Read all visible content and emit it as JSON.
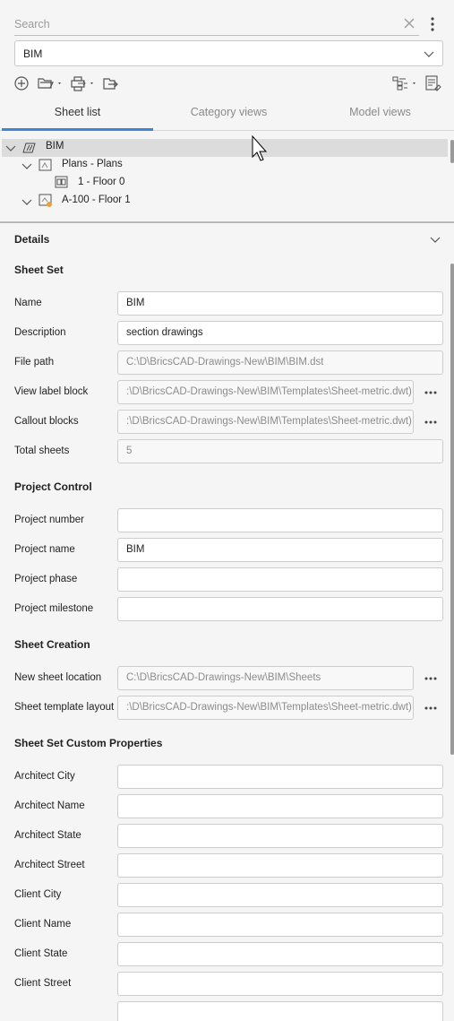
{
  "search": {
    "placeholder": "Search"
  },
  "sheetset_select": {
    "value": "BIM"
  },
  "tabs": [
    {
      "label": "Sheet list",
      "active": true
    },
    {
      "label": "Category views",
      "active": false
    },
    {
      "label": "Model views",
      "active": false
    }
  ],
  "tree": {
    "root": "BIM",
    "subset": "Plans - Plans",
    "view": "1 - Floor 0",
    "sheet": "A-100 - Floor 1"
  },
  "details": {
    "title": "Details",
    "sheet_set": {
      "title": "Sheet Set",
      "name_label": "Name",
      "name_value": "BIM",
      "description_label": "Description",
      "description_value": "section drawings",
      "file_path_label": "File path",
      "file_path_value": "C:\\D\\BricsCAD-Drawings-New\\BIM\\BIM.dst",
      "view_label_block_label": "View label block",
      "view_label_block_value": ":\\D\\BricsCAD-Drawings-New\\BIM\\Templates\\Sheet-metric.dwt)",
      "callout_blocks_label": "Callout blocks",
      "callout_blocks_value": ":\\D\\BricsCAD-Drawings-New\\BIM\\Templates\\Sheet-metric.dwt)",
      "total_sheets_label": "Total sheets",
      "total_sheets_value": "5"
    },
    "project_control": {
      "title": "Project Control",
      "project_number_label": "Project number",
      "project_number_value": "",
      "project_name_label": "Project name",
      "project_name_value": "BIM",
      "project_phase_label": "Project phase",
      "project_phase_value": "",
      "project_milestone_label": "Project milestone",
      "project_milestone_value": ""
    },
    "sheet_creation": {
      "title": "Sheet Creation",
      "new_sheet_location_label": "New sheet location",
      "new_sheet_location_value": "C:\\D\\BricsCAD-Drawings-New\\BIM\\Sheets",
      "sheet_template_layout_label": "Sheet template layout",
      "sheet_template_layout_value": ":\\D\\BricsCAD-Drawings-New\\BIM\\Templates\\Sheet-metric.dwt)"
    },
    "custom_properties": {
      "title": "Sheet Set Custom Properties",
      "architect_city_label": "Architect City",
      "architect_name_label": "Architect Name",
      "architect_state_label": "Architect State",
      "architect_street_label": "Architect Street",
      "client_city_label": "Client City",
      "client_name_label": "Client Name",
      "client_state_label": "Client State",
      "client_street_label": "Client Street"
    }
  },
  "colors": {
    "accent": "#3d86d6",
    "selection": "#dcdcdc",
    "background": "#f5f5f5"
  }
}
